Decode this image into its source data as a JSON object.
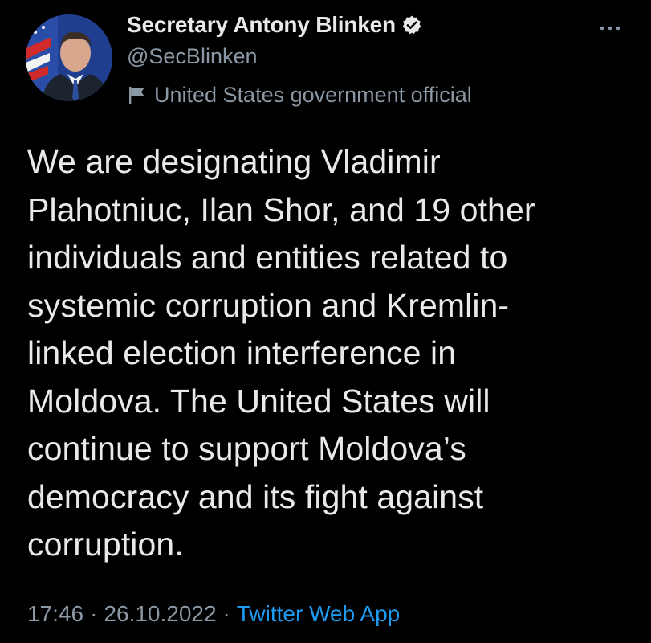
{
  "tweet": {
    "author": {
      "display_name": "Secretary Antony Blinken",
      "handle": "@SecBlinken",
      "label": "United States government official",
      "verified_icon": "verified-badge-icon",
      "label_icon": "flag-icon"
    },
    "more_icon": "ellipsis-icon",
    "text": "We are designating Vladimir\nPlahotniuc, Ilan Shor, and 19 other\nindividuals and entities related to\nsystemic corruption and Kremlin-\nlinked election interference in\nMoldova. The United States will\ncontinue to support Moldova’s\ndemocracy and its fight against\ncorruption.",
    "time": "17:46",
    "separator": "·",
    "date": "26.10.2022",
    "source": "Twitter Web App"
  },
  "colors": {
    "background": "#000000",
    "text_primary": "#e7e9ea",
    "text_secondary": "#8b98a5",
    "link": "#1d9bf0"
  }
}
